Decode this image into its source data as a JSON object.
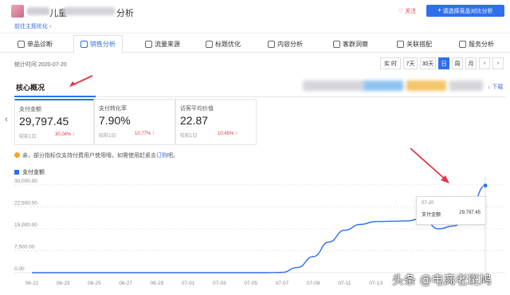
{
  "header": {
    "shop_name": "儿童",
    "shop_suffix": "分析",
    "theme_link": "前往主题优化 ›",
    "follow_label": "关注",
    "compare_label": "请选择竞品对比分析"
  },
  "tabs": [
    {
      "label": "单品诊断",
      "active": false
    },
    {
      "label": "销售分析",
      "active": true
    },
    {
      "label": "流量来源",
      "active": false
    },
    {
      "label": "标题优化",
      "active": false
    },
    {
      "label": "内容分析",
      "active": false
    },
    {
      "label": "客群洞察",
      "active": false
    },
    {
      "label": "关联搭配",
      "active": false
    },
    {
      "label": "服务分析",
      "active": false
    }
  ],
  "stat_time": "统计时间 2020-07-20",
  "range_buttons": [
    {
      "label": "实 时",
      "active": false
    },
    {
      "label": "7天",
      "active": false
    },
    {
      "label": "30天",
      "active": false
    },
    {
      "label": "日",
      "active": true
    },
    {
      "label": "周",
      "active": false
    },
    {
      "label": "月",
      "active": false
    },
    {
      "label": "‹",
      "active": false
    },
    {
      "label": "›",
      "active": false
    }
  ],
  "core": {
    "title": "核心概况",
    "download": "↓ 下载"
  },
  "metrics": [
    {
      "label": "支付金额",
      "value": "29,797.45",
      "compare": "较前1日",
      "delta": "30.04% ↑"
    },
    {
      "label": "支付转化率",
      "value": "7.90%",
      "compare": "较前1日",
      "delta": "10.77% ↑"
    },
    {
      "label": "访客平均价值",
      "value": "22.87",
      "compare": "较前1日",
      "delta": "10.45% ↑"
    }
  ],
  "notice": {
    "text": "亲，部分指标仅支持付费用户使用哦，如需使用赶紧去",
    "link": "订购",
    "tail": "吧。"
  },
  "colors": {
    "accent": "#2f6fed",
    "alert": "#e0364b",
    "notice_dot": "#f5a623"
  },
  "chart_data": {
    "type": "line",
    "series": [
      {
        "name": "支付金额",
        "values": [
          0,
          0,
          0,
          0,
          0,
          0,
          0,
          0,
          0,
          0,
          0,
          0,
          0,
          0,
          0,
          0,
          100,
          1800,
          5500,
          10500,
          14500,
          16500,
          17500,
          17600,
          17700,
          18600,
          15000,
          16000,
          21500,
          29797.45
        ]
      }
    ],
    "x": [
      "06-21",
      "06-22",
      "06-23",
      "06-24",
      "06-25",
      "06-26",
      "06-27",
      "06-28",
      "06-29",
      "06-30",
      "07-01",
      "07-02",
      "07-03",
      "07-04",
      "07-05",
      "07-06",
      "07-07",
      "07-08",
      "07-09",
      "07-10",
      "07-11",
      "07-12",
      "07-13",
      "07-14",
      "07-15",
      "07-16",
      "07-17",
      "07-18",
      "07-19",
      "07-20"
    ],
    "x_ticks": [
      "06-21",
      "06-23",
      "06-25",
      "06-27",
      "06-29",
      "07-01",
      "07-03",
      "07-05",
      "07-07",
      "07-09",
      "07-11",
      "07-13"
    ],
    "y_ticks": [
      "0.00",
      "7,500.00",
      "15,000.00",
      "22,500.00",
      "30,000.00"
    ],
    "ylim": [
      0,
      30000
    ],
    "grid": true,
    "legend_position": "top-left",
    "tooltip": {
      "date": "07-20",
      "label": "支付金额",
      "value": "29,797.45"
    }
  },
  "watermark": "头条 @电商老斑鸠"
}
